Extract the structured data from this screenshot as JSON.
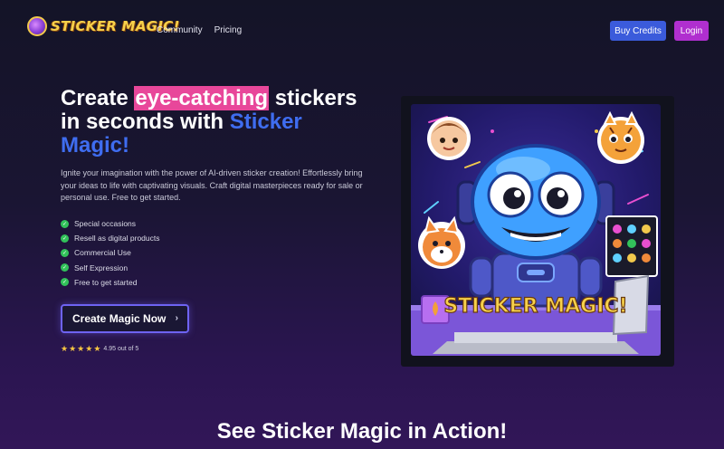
{
  "nav": {
    "logo_text": "STICKER MAGIC!",
    "links": [
      "Community",
      "Pricing"
    ],
    "buy_credits": "Buy Credits",
    "login": "Login"
  },
  "hero": {
    "title_pre": "Create ",
    "title_highlight": "eye-catching",
    "title_mid": " stickers in seconds with ",
    "title_brand": "Sticker Magic!",
    "description": "Ignite your imagination with the power of AI-driven sticker creation! Effortlessly bring your ideas to life with captivating visuals. Craft digital masterpieces ready for sale or personal use. Free to get started.",
    "features": [
      "Special occasions",
      "Resell as digital products",
      "Commercial Use",
      "Self Expression",
      "Free to get started"
    ],
    "cta_label": "Create Magic Now",
    "cta_icon": "chevron-right-icon",
    "rating_text": "4.95 out of 5",
    "rating_stars": 5,
    "image_banner_text": "STICKER MAGIC!"
  },
  "section": {
    "title": "See Sticker Magic in Action!"
  },
  "colors": {
    "highlight": "#e8479a",
    "brand_blue": "#3f6df0",
    "buy_credits_bg": "#3b5bdb",
    "login_bg": "#b02fcf",
    "check_green": "#32c25a",
    "star_gold": "#f5c542"
  }
}
